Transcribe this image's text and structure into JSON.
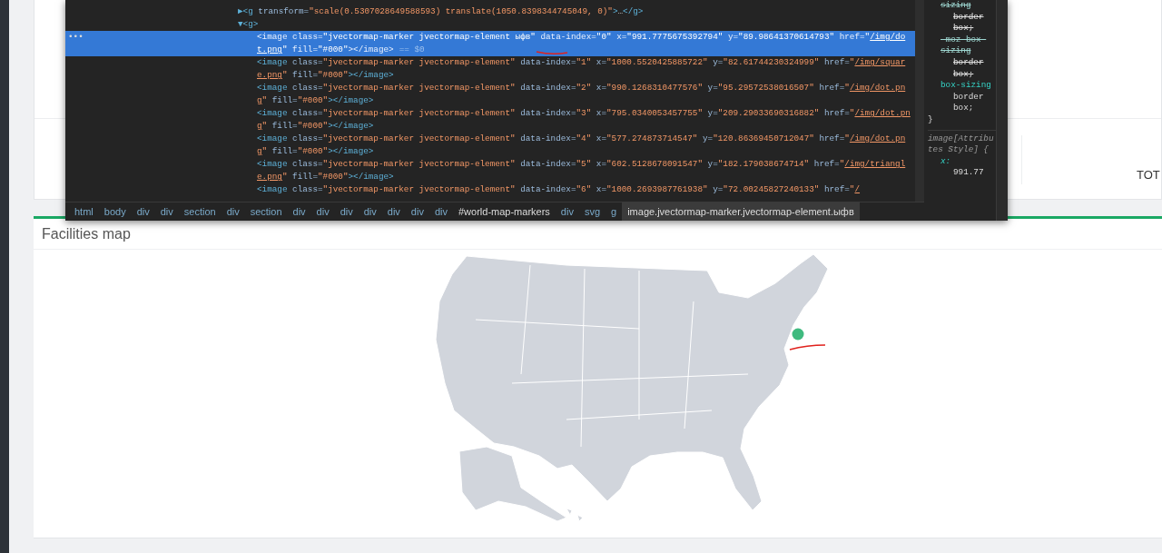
{
  "top_card": {
    "column_label": "TOT"
  },
  "devtools": {
    "ellipsis": "•••",
    "tree": [
      {
        "tokens": [
          {
            "kind": "toggle",
            "text": "▶"
          },
          {
            "kind": "tag",
            "text": "<g"
          },
          {
            "kind": "attr",
            "text": " transform="
          },
          {
            "kind": "value",
            "text": "\"scale(0.5307028649588593) translate(1050.8398344745049, 0)\""
          },
          {
            "kind": "tag",
            "text": ">"
          },
          {
            "kind": "text",
            "text": "…"
          },
          {
            "kind": "tag",
            "text": "</g>"
          }
        ]
      },
      {
        "expanded": true,
        "tokens": [
          {
            "kind": "toggle",
            "text": "▼"
          },
          {
            "kind": "tag",
            "text": "<g>"
          }
        ],
        "children": [
          {
            "selected": true,
            "tokens": [
              {
                "kind": "tag",
                "text": "<image"
              },
              {
                "kind": "attr",
                "text": " class="
              },
              {
                "kind": "value",
                "text": "\"jvectormap-marker jvectormap-element ыфв\""
              },
              {
                "kind": "attr",
                "text": " data-index="
              },
              {
                "kind": "value",
                "text": "\"0\""
              },
              {
                "kind": "attr",
                "text": " x="
              },
              {
                "kind": "value",
                "text": "\"991.7775675392794\""
              },
              {
                "kind": "attr",
                "text": " y="
              },
              {
                "kind": "value",
                "text": "\"89.98641370614793\""
              },
              {
                "kind": "attr",
                "text": " href="
              },
              {
                "kind": "value",
                "text": "\""
              },
              {
                "kind": "link",
                "text": "/img/dot.png"
              },
              {
                "kind": "value",
                "text": "\""
              },
              {
                "kind": "attr",
                "text": " fill="
              },
              {
                "kind": "value",
                "text": "\"#000\""
              },
              {
                "kind": "tag",
                "text": "></image>"
              },
              {
                "kind": "ref",
                "text": "== $0"
              }
            ]
          },
          {
            "selected": false,
            "tokens": [
              {
                "kind": "tag",
                "text": "<image"
              },
              {
                "kind": "attr",
                "text": " class="
              },
              {
                "kind": "value",
                "text": "\"jvectormap-marker jvectormap-element\""
              },
              {
                "kind": "attr",
                "text": " data-index="
              },
              {
                "kind": "value",
                "text": "\"1\""
              },
              {
                "kind": "attr",
                "text": " x="
              },
              {
                "kind": "value",
                "text": "\"1000.5520425885722\""
              },
              {
                "kind": "attr",
                "text": " y="
              },
              {
                "kind": "value",
                "text": "\"82.61744230324999\""
              },
              {
                "kind": "attr",
                "text": " href="
              },
              {
                "kind": "value",
                "text": "\""
              },
              {
                "kind": "link",
                "text": "/img/square.png"
              },
              {
                "kind": "value",
                "text": "\""
              },
              {
                "kind": "attr",
                "text": " fill="
              },
              {
                "kind": "value",
                "text": "\"#000\""
              },
              {
                "kind": "tag",
                "text": "></image>"
              }
            ]
          },
          {
            "selected": false,
            "tokens": [
              {
                "kind": "tag",
                "text": "<image"
              },
              {
                "kind": "attr",
                "text": " class="
              },
              {
                "kind": "value",
                "text": "\"jvectormap-marker jvectormap-element\""
              },
              {
                "kind": "attr",
                "text": " data-index="
              },
              {
                "kind": "value",
                "text": "\"2\""
              },
              {
                "kind": "attr",
                "text": " x="
              },
              {
                "kind": "value",
                "text": "\"990.1268310477576\""
              },
              {
                "kind": "attr",
                "text": " y="
              },
              {
                "kind": "value",
                "text": "\"95.29572538016507\""
              },
              {
                "kind": "attr",
                "text": " href="
              },
              {
                "kind": "value",
                "text": "\""
              },
              {
                "kind": "link",
                "text": "/img/dot.png"
              },
              {
                "kind": "value",
                "text": "\""
              },
              {
                "kind": "attr",
                "text": " fill="
              },
              {
                "kind": "value",
                "text": "\"#000\""
              },
              {
                "kind": "tag",
                "text": "></image>"
              }
            ]
          },
          {
            "selected": false,
            "tokens": [
              {
                "kind": "tag",
                "text": "<image"
              },
              {
                "kind": "attr",
                "text": " class="
              },
              {
                "kind": "value",
                "text": "\"jvectormap-marker jvectormap-element\""
              },
              {
                "kind": "attr",
                "text": " data-index="
              },
              {
                "kind": "value",
                "text": "\"3\""
              },
              {
                "kind": "attr",
                "text": " x="
              },
              {
                "kind": "value",
                "text": "\"795.0340053457755\""
              },
              {
                "kind": "attr",
                "text": " y="
              },
              {
                "kind": "value",
                "text": "\"209.29033690316882\""
              },
              {
                "kind": "attr",
                "text": " href="
              },
              {
                "kind": "value",
                "text": "\""
              },
              {
                "kind": "link",
                "text": "/img/dot.png"
              },
              {
                "kind": "value",
                "text": "\""
              },
              {
                "kind": "attr",
                "text": " fill="
              },
              {
                "kind": "value",
                "text": "\"#000\""
              },
              {
                "kind": "tag",
                "text": "></image>"
              }
            ]
          },
          {
            "selected": false,
            "tokens": [
              {
                "kind": "tag",
                "text": "<image"
              },
              {
                "kind": "attr",
                "text": " class="
              },
              {
                "kind": "value",
                "text": "\"jvectormap-marker jvectormap-element\""
              },
              {
                "kind": "attr",
                "text": " data-index="
              },
              {
                "kind": "value",
                "text": "\"4\""
              },
              {
                "kind": "attr",
                "text": " x="
              },
              {
                "kind": "value",
                "text": "\"577.274873714547\""
              },
              {
                "kind": "attr",
                "text": " y="
              },
              {
                "kind": "value",
                "text": "\"120.86369450712047\""
              },
              {
                "kind": "attr",
                "text": " href="
              },
              {
                "kind": "value",
                "text": "\""
              },
              {
                "kind": "link",
                "text": "/img/dot.png"
              },
              {
                "kind": "value",
                "text": "\""
              },
              {
                "kind": "attr",
                "text": " fill="
              },
              {
                "kind": "value",
                "text": "\"#000\""
              },
              {
                "kind": "tag",
                "text": "></image>"
              }
            ]
          },
          {
            "selected": false,
            "tokens": [
              {
                "kind": "tag",
                "text": "<image"
              },
              {
                "kind": "attr",
                "text": " class="
              },
              {
                "kind": "value",
                "text": "\"jvectormap-marker jvectormap-element\""
              },
              {
                "kind": "attr",
                "text": " data-index="
              },
              {
                "kind": "value",
                "text": "\"5\""
              },
              {
                "kind": "attr",
                "text": " x="
              },
              {
                "kind": "value",
                "text": "\"602.5128678091547\""
              },
              {
                "kind": "attr",
                "text": " y="
              },
              {
                "kind": "value",
                "text": "\"182.179038674714\""
              },
              {
                "kind": "attr",
                "text": " href="
              },
              {
                "kind": "value",
                "text": "\""
              },
              {
                "kind": "link",
                "text": "/img/triangle.png"
              },
              {
                "kind": "value",
                "text": "\""
              },
              {
                "kind": "attr",
                "text": " fill="
              },
              {
                "kind": "value",
                "text": "\"#000\""
              },
              {
                "kind": "tag",
                "text": "></image>"
              }
            ]
          },
          {
            "selected": false,
            "tokens": [
              {
                "kind": "tag",
                "text": "<image"
              },
              {
                "kind": "attr",
                "text": " class="
              },
              {
                "kind": "value",
                "text": "\"jvectormap-marker jvectormap-element\""
              },
              {
                "kind": "attr",
                "text": " data-index="
              },
              {
                "kind": "value",
                "text": "\"6\""
              },
              {
                "kind": "attr",
                "text": " x="
              },
              {
                "kind": "value",
                "text": "\"1000.2693987761938\""
              },
              {
                "kind": "attr",
                "text": " y="
              },
              {
                "kind": "value",
                "text": "\"72.00245827240133\""
              },
              {
                "kind": "attr",
                "text": " href="
              },
              {
                "kind": "value",
                "text": "\""
              },
              {
                "kind": "link",
                "text": "/"
              }
            ]
          }
        ]
      }
    ],
    "breadcrumbs": [
      {
        "label": "html",
        "selected": false
      },
      {
        "label": "body",
        "selected": false
      },
      {
        "label": "div",
        "selected": false
      },
      {
        "label": "div",
        "selected": false
      },
      {
        "label": "section",
        "selected": false
      },
      {
        "label": "div",
        "selected": false
      },
      {
        "label": "section",
        "selected": false
      },
      {
        "label": "div",
        "selected": false
      },
      {
        "label": "div",
        "selected": false
      },
      {
        "label": "div",
        "selected": false
      },
      {
        "label": "div",
        "selected": false
      },
      {
        "label": "div",
        "selected": false
      },
      {
        "label": "div",
        "selected": false
      },
      {
        "label": "div",
        "selected": false
      },
      {
        "label": "#world-map-markers",
        "selected": false
      },
      {
        "label": "div",
        "selected": false
      },
      {
        "label": "svg",
        "selected": false
      },
      {
        "label": "g",
        "selected": false
      },
      {
        "label": "image.jvectormap-marker.jvectormap-element.ыфв",
        "selected": true
      }
    ],
    "styles": {
      "rules": [
        {
          "property": "sizing",
          "value": "border box;",
          "overridden": true
        },
        {
          "property": "-moz-box-sizing",
          "value": "border box;",
          "overridden": true
        },
        {
          "property": "box-sizing",
          "value": "border box;",
          "overridden": false
        }
      ],
      "close": "}",
      "selector": "image[Attributes Style] {",
      "attr_rule": {
        "property": "x:",
        "value": "991.77"
      }
    }
  },
  "map_card": {
    "title": "Facilities map"
  }
}
